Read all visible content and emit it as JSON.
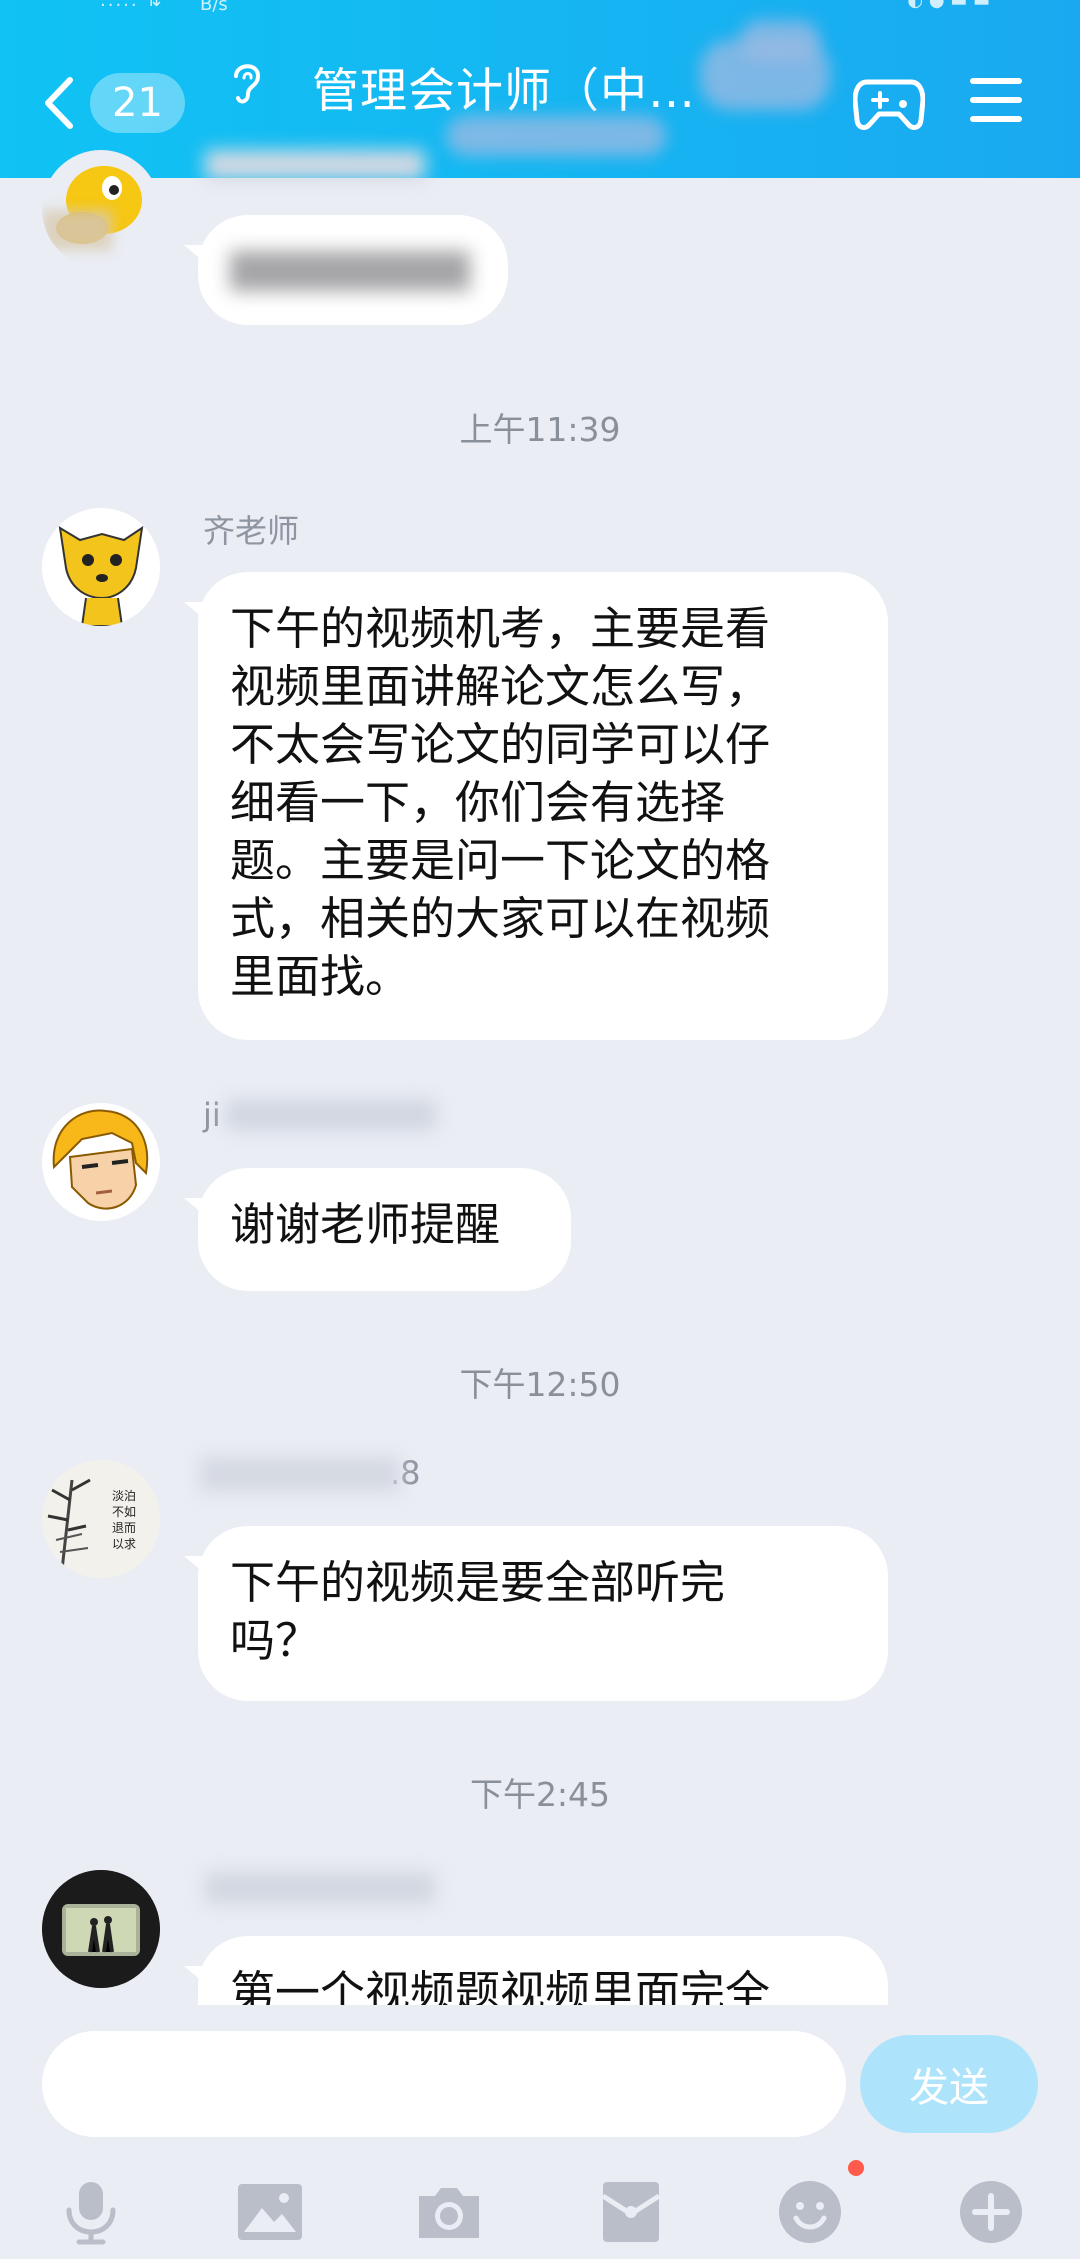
{
  "header": {
    "status_speed": "B/s",
    "back_badge": "21",
    "title": "管理会计师（中…",
    "colors": {
      "gradient_start": "#10c3f4",
      "gradient_end": "#1aa9f0"
    }
  },
  "messages": [
    {
      "type": "message",
      "sender": "",
      "avatar": "duck-avatar",
      "text": "",
      "blurred": true
    },
    {
      "type": "time",
      "text": "上午11:39"
    },
    {
      "type": "message",
      "sender": "齐老师",
      "avatar": "yellow-dog-avatar",
      "text": "下午的视频机考，主要是看\n视频里面讲解论文怎么写，\n不太会写论文的同学可以仔\n细看一下，你们会有选择\n题。主要是问一下论文的格\n式，相关的大家可以在视频\n里面找。"
    },
    {
      "type": "message",
      "sender": "ji",
      "avatar": "blond-boy-avatar",
      "text": "谢谢老师提醒"
    },
    {
      "type": "time",
      "text": "下午12:50"
    },
    {
      "type": "message",
      "sender": ".8",
      "avatar": "bamboo-painting-avatar",
      "text": "下午的视频是要全部听完\n吗？"
    },
    {
      "type": "time",
      "text": "下午2:45"
    },
    {
      "type": "message",
      "sender": "",
      "avatar": "camera-photo-avatar",
      "text": "第一个视频题视频里面完全"
    }
  ],
  "input": {
    "value": "",
    "placeholder": "",
    "send_label": "发送"
  },
  "toolbar": {
    "icons": [
      "microphone-icon",
      "image-icon",
      "camera-icon",
      "red-packet-icon",
      "emoji-icon",
      "plus-icon"
    ]
  }
}
